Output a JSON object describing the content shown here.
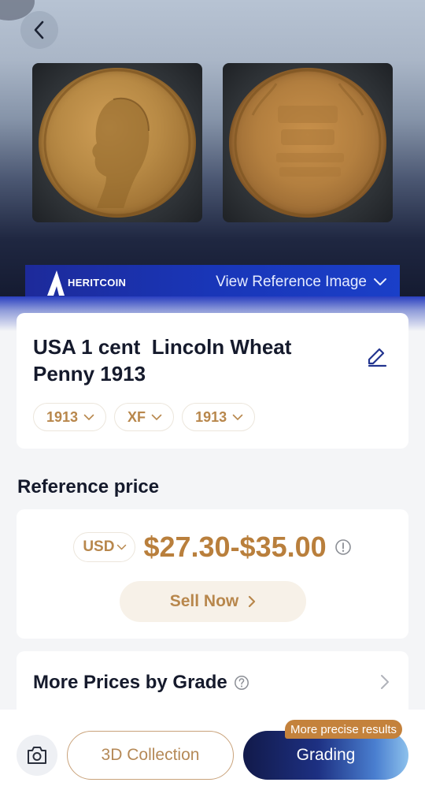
{
  "hero": {
    "brand": "HERITCOIN",
    "view_reference": "View Reference Image"
  },
  "coin": {
    "title": "USA 1 cent  Lincoln Wheat Penny 1913",
    "chips": [
      "1913",
      "XF",
      "1913"
    ]
  },
  "reference": {
    "section_title": "Reference price",
    "currency": "USD",
    "price_range": "$27.30-$35.00",
    "sell_label": "Sell Now"
  },
  "grades": {
    "label": "More Prices by Grade"
  },
  "bottom": {
    "collection_label": "3D Collection",
    "grading_label": "Grading",
    "badge": "More precise results"
  },
  "colors": {
    "accent_gold": "#b97f3c",
    "brand_blue": "#1936b8",
    "text_dark": "#151a2c"
  }
}
